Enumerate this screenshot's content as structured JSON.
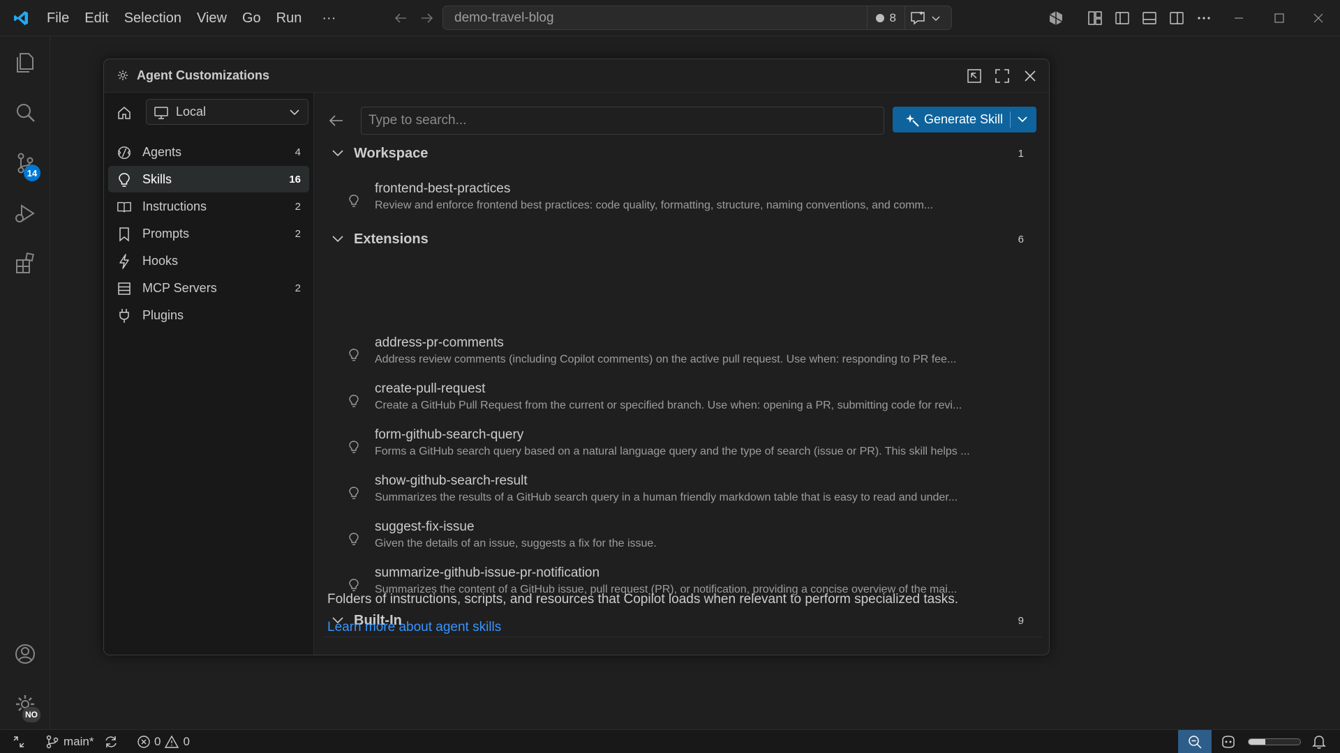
{
  "titlebar": {
    "menus": [
      "File",
      "Edit",
      "Selection",
      "View",
      "Go",
      "Run"
    ],
    "more_label": "···",
    "search_text": "demo-travel-blog",
    "agent_count": "8"
  },
  "activitybar": {
    "source_control_badge": "14",
    "accounts_badge": "NO"
  },
  "dialog": {
    "title": "Agent Customizations",
    "scope": "Local",
    "nav": [
      {
        "label": "Agents",
        "count": "4",
        "icon": "agent-icon"
      },
      {
        "label": "Skills",
        "count": "16",
        "icon": "lightbulb-icon"
      },
      {
        "label": "Instructions",
        "count": "2",
        "icon": "book-icon"
      },
      {
        "label": "Prompts",
        "count": "2",
        "icon": "bookmark-icon"
      },
      {
        "label": "Hooks",
        "count": "",
        "icon": "bolt-icon"
      },
      {
        "label": "MCP Servers",
        "count": "2",
        "icon": "server-icon"
      },
      {
        "label": "Plugins",
        "count": "",
        "icon": "plug-icon"
      }
    ],
    "search_placeholder": "Type to search...",
    "generate_label": "Generate Skill",
    "groups": {
      "workspace": {
        "title": "Workspace",
        "count": "1",
        "items": [
          {
            "name": "frontend-best-practices",
            "desc": "Review and enforce frontend best practices: code quality, formatting, structure, naming conventions, and comm..."
          }
        ]
      },
      "extensions": {
        "title": "Extensions",
        "count": "6",
        "items": [
          {
            "name": "address-pr-comments",
            "desc": "Address review comments (including Copilot comments) on the active pull request. Use when: responding to PR fee..."
          },
          {
            "name": "create-pull-request",
            "desc": "Create a GitHub Pull Request from the current or specified branch. Use when: opening a PR, submitting code for revi..."
          },
          {
            "name": "form-github-search-query",
            "desc": "Forms a GitHub search query based on a natural language query and the type of search (issue or PR). This skill helps ..."
          },
          {
            "name": "show-github-search-result",
            "desc": "Summarizes the results of a GitHub search query in a human friendly markdown table that is easy to read and under..."
          },
          {
            "name": "suggest-fix-issue",
            "desc": "Given the details of an issue, suggests a fix for the issue."
          },
          {
            "name": "summarize-github-issue-pr-notification",
            "desc": "Summarizes the content of a GitHub issue, pull request (PR), or notification, providing a concise overview of the mai..."
          }
        ]
      },
      "builtin": {
        "title": "Built-In",
        "count": "9"
      }
    },
    "footer_desc": "Folders of instructions, scripts, and resources that Copilot loads when relevant to perform specialized tasks.",
    "footer_link": "Learn more about agent skills"
  },
  "statusbar": {
    "branch": "main*",
    "errors": "0",
    "warnings": "0",
    "zoom_fraction": 0.33
  },
  "colors": {
    "accent": "#0e639c",
    "link": "#3794ff",
    "badge": "#0078d4"
  }
}
